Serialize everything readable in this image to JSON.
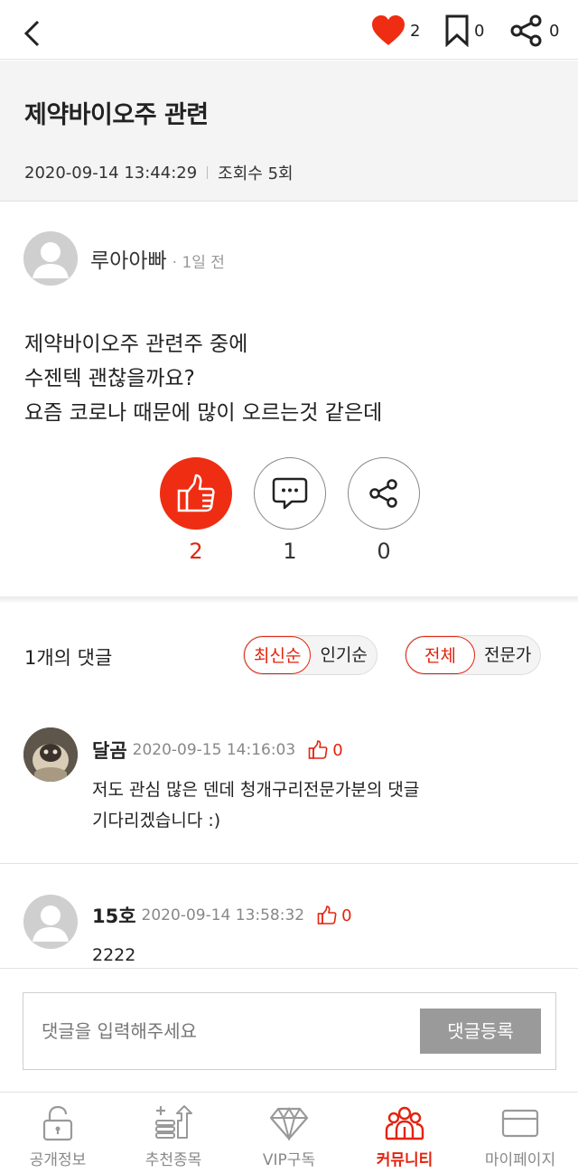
{
  "header": {
    "like_count": "2",
    "bookmark_count": "0",
    "share_count": "0",
    "icons": {
      "back": "chevron-left-icon",
      "like": "heart-icon",
      "bookmark": "bookmark-icon",
      "share": "share-icon"
    }
  },
  "post": {
    "title": "제약바이오주 관련",
    "datetime": "2020-09-14 13:44:29",
    "views": "조회수 5회",
    "author": "루아아빠",
    "time_ago": "· 1일 전",
    "body_lines": [
      "제약바이오주 관련주 중에",
      "수젠텍 괜찮을까요?",
      "요즘 코로나 때문에 많이 오르는것 같은데"
    ]
  },
  "reactions": {
    "like_count": "2",
    "comment_count": "1",
    "share_count": "0"
  },
  "comments_header": {
    "count_label": "1개의 댓글",
    "sort_options": [
      "최신순",
      "인기순"
    ],
    "filter_options": [
      "전체",
      "전문가"
    ]
  },
  "comments": [
    {
      "name": "달곰",
      "date": "2020-09-15 14:16:03",
      "likes": "0",
      "text_lines": [
        "저도 관심 많은 덴데 청개구리전문가분의 댓글",
        "기다리겠습니다 :)"
      ]
    },
    {
      "name": "15호",
      "date": "2020-09-14 13:58:32",
      "likes": "0",
      "text_lines": [
        "2222"
      ]
    }
  ],
  "comment_input": {
    "placeholder": "댓글을 입력해주세요",
    "value": "",
    "submit_label": "댓글등록"
  },
  "nav": {
    "items": [
      {
        "label": "공개정보",
        "icon": "unlock-icon",
        "active": false
      },
      {
        "label": "추천종목",
        "icon": "stock-recommend-icon",
        "active": false
      },
      {
        "label": "VIP구독",
        "icon": "diamond-icon",
        "active": false
      },
      {
        "label": "커뮤니티",
        "icon": "community-icon",
        "active": true
      },
      {
        "label": "마이페이지",
        "icon": "card-icon",
        "active": false
      }
    ]
  },
  "colors": {
    "accent": "#e3230e",
    "like_button": "#ef2d12",
    "submit_button": "#9a9a9a",
    "title_bg": "#f4f4f4"
  }
}
